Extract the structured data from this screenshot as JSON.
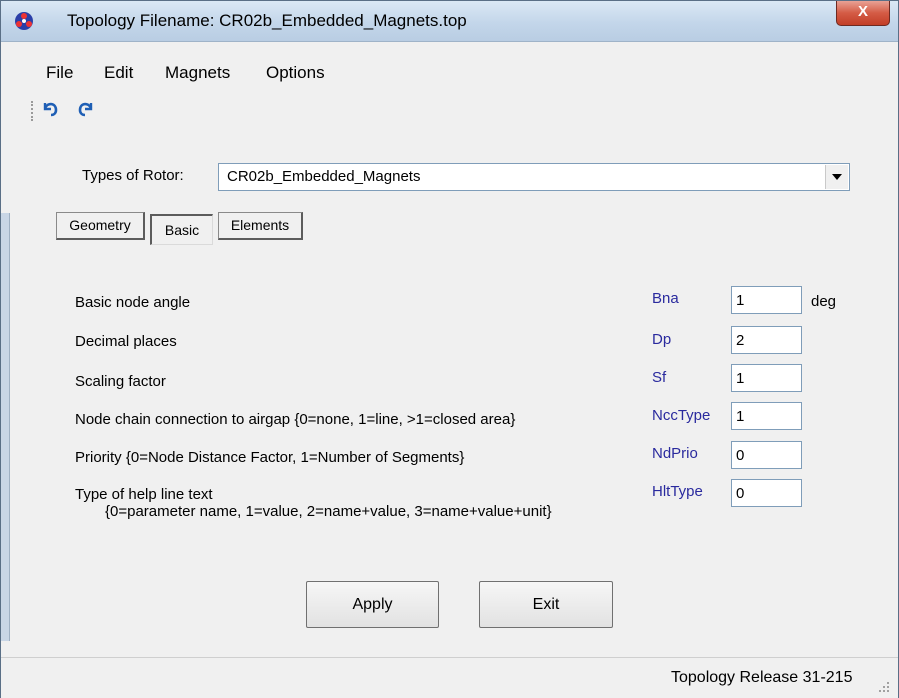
{
  "window": {
    "title": "Topology Filename: CR02b_Embedded_Magnets.top",
    "close_symbol": "X",
    "app_icon": "app-logo-icon"
  },
  "menu": {
    "items": [
      "File",
      "Edit",
      "Magnets",
      "Options"
    ]
  },
  "toolbar": {
    "undo_icon": "undo-icon",
    "redo_icon": "redo-icon"
  },
  "rotor": {
    "label": "Types of Rotor:",
    "selected": "CR02b_Embedded_Magnets"
  },
  "tabs": [
    {
      "label": "Geometry",
      "active": false
    },
    {
      "label": "Basic",
      "active": true
    },
    {
      "label": "Elements",
      "active": false
    }
  ],
  "params": [
    {
      "label": "Basic node angle",
      "name": "Bna",
      "value": "1",
      "unit": "deg"
    },
    {
      "label": "Decimal places",
      "name": "Dp",
      "value": "2",
      "unit": ""
    },
    {
      "label": "Scaling factor",
      "name": "Sf",
      "value": "1",
      "unit": ""
    },
    {
      "label": "Node chain connection to airgap {0=none, 1=line, >1=closed area}",
      "name": "NccType",
      "value": "1",
      "unit": ""
    },
    {
      "label": "Priority {0=Node Distance Factor, 1=Number of Segments}",
      "name": "NdPrio",
      "value": "0",
      "unit": ""
    },
    {
      "label": "Type of help line text",
      "sublabel": "{0=parameter name, 1=value, 2=name+value, 3=name+value+unit}",
      "name": "HltType",
      "value": "0",
      "unit": ""
    }
  ],
  "buttons": {
    "apply": "Apply",
    "exit": "Exit"
  },
  "status": {
    "text": "Topology Release 31-215"
  },
  "colors": {
    "param_name": "#2a2a9e",
    "close_button": "#c8472f",
    "icon_blue": "#1f5fb5"
  }
}
